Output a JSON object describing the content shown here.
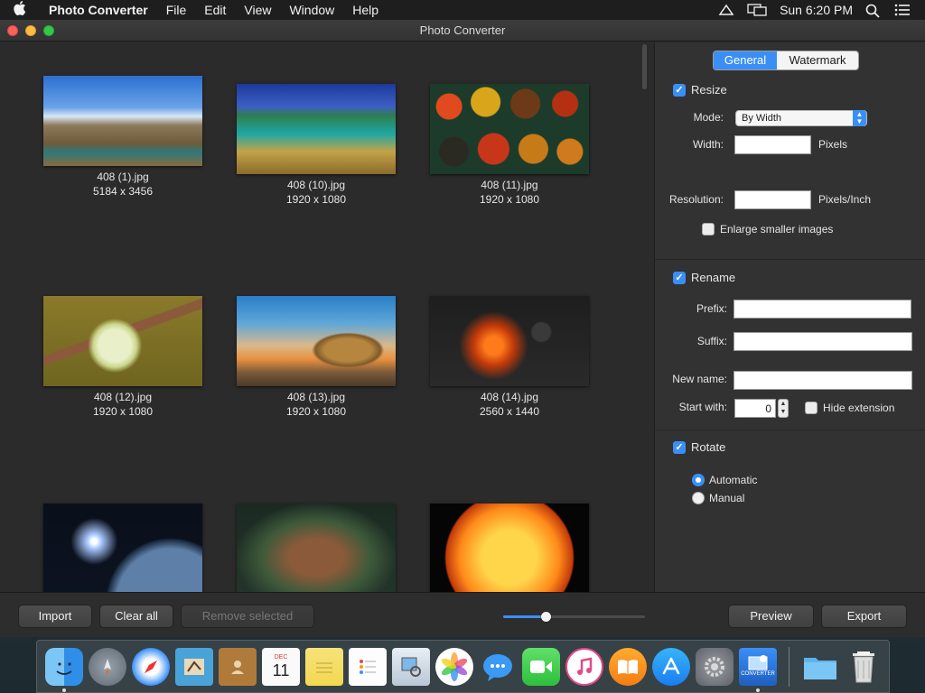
{
  "menubar": {
    "apple": "",
    "app_name": "Photo Converter",
    "items": [
      "File",
      "Edit",
      "View",
      "Window",
      "Help"
    ],
    "clock": "Sun 6:20 PM"
  },
  "window": {
    "title": "Photo Converter"
  },
  "gallery": {
    "items": [
      {
        "name": "408 (1).jpg",
        "dims": "5184 x 3456"
      },
      {
        "name": "408 (10).jpg",
        "dims": "1920 x 1080"
      },
      {
        "name": "408 (11).jpg",
        "dims": "1920 x 1080"
      },
      {
        "name": "408 (12).jpg",
        "dims": "1920 x 1080"
      },
      {
        "name": "408 (13).jpg",
        "dims": "1920 x 1080"
      },
      {
        "name": "408 (14).jpg",
        "dims": "2560 x 1440"
      }
    ]
  },
  "panel": {
    "tabs": {
      "general": "General",
      "watermark": "Watermark"
    },
    "resize": {
      "label": "Resize",
      "mode_label": "Mode:",
      "mode_value": "By Width",
      "width_label": "Width:",
      "width_unit": "Pixels",
      "resolution_label": "Resolution:",
      "resolution_unit": "Pixels/Inch",
      "enlarge_label": "Enlarge smaller images"
    },
    "rename": {
      "label": "Rename",
      "prefix_label": "Prefix:",
      "suffix_label": "Suffix:",
      "newname_label": "New name:",
      "startwith_label": "Start with:",
      "startwith_value": "0",
      "hide_ext_label": "Hide extension"
    },
    "rotate": {
      "label": "Rotate",
      "automatic": "Automatic",
      "manual": "Manual"
    }
  },
  "toolbar": {
    "import": "Import",
    "clear_all": "Clear all",
    "remove_selected": "Remove selected",
    "preview": "Preview",
    "export": "Export",
    "zoom_fraction": 0.3
  },
  "dock": {
    "icons": [
      "finder-icon",
      "launchpad-icon",
      "safari-icon",
      "mail-icon",
      "contacts-icon",
      "calendar-icon",
      "notes-icon",
      "reminders-icon",
      "preview-icon",
      "photos-icon",
      "messages-icon",
      "facetime-icon",
      "itunes-icon",
      "ibooks-icon",
      "app-store-icon",
      "system-preferences-icon",
      "photo-converter-icon",
      "downloads-folder-icon",
      "trash-icon"
    ],
    "calendar_month": "DEC",
    "calendar_day": "11",
    "converter_label": "CONVERTER"
  },
  "colors": {
    "accent": "#3a8ff6",
    "window_bg": "#2b2b2b",
    "panel_bg": "#323232"
  }
}
